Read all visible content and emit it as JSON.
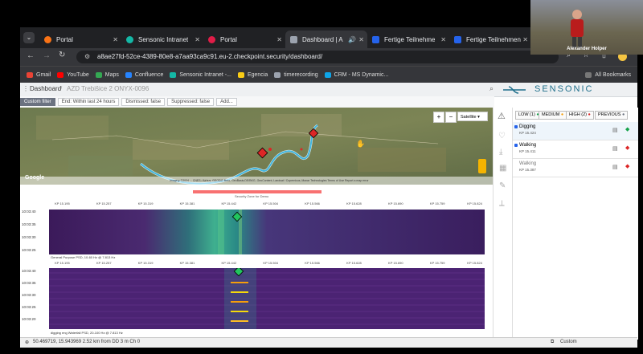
{
  "browser": {
    "tabs": [
      {
        "label": "Portal",
        "color": "#f97316",
        "active": false
      },
      {
        "label": "Sensonic Intranet",
        "color": "#14b8a6",
        "active": false
      },
      {
        "label": "Portal",
        "color": "#e11d48",
        "active": false
      },
      {
        "label": "Dashboard | A",
        "color": "#9ca3af",
        "active": true
      },
      {
        "label": "Fertige Teilnehme",
        "color": "#2563eb",
        "active": false
      },
      {
        "label": "Fertige Teilnehmen",
        "color": "#2563eb",
        "active": false
      }
    ],
    "url": "a8ae27fd-52ce-4389-80e8-a7aa93ca9c91.eu-2.checkpoint.security/dashboard/",
    "bookmarks": [
      {
        "label": "Gmail",
        "color": "#ea4335"
      },
      {
        "label": "YouTube",
        "color": "#ff0000"
      },
      {
        "label": "Maps",
        "color": "#34a853"
      },
      {
        "label": "Confluence",
        "color": "#2684ff"
      },
      {
        "label": "Sensonic Intranet -...",
        "color": "#14b8a6"
      },
      {
        "label": "Egencia",
        "color": "#facc15"
      },
      {
        "label": "timerecording",
        "color": "#9ca3af"
      },
      {
        "label": "CRM - MS Dynamic...",
        "color": "#0ea5e9"
      }
    ],
    "all_bookmarks": "All Bookmarks"
  },
  "webcam": {
    "name": "Alexander Holper"
  },
  "app": {
    "breadcrumb": "Dashboard",
    "asset": "AZD Trebišice 2 ONYX-0096",
    "brand": "SENSONIC",
    "filters": {
      "label": "Custom filter",
      "chips": [
        "End: Within last 24 hours",
        "Dismissed: false",
        "Suppressed: false",
        "Add..."
      ]
    },
    "map": {
      "layer": "Satellite",
      "zoom_in": "+",
      "zoom_out": "−",
      "google": "Google",
      "attribution": "Imagery ©2024 ... CNES / Airbus, GEODIS Brno, GeoBasis-DE/BKG, GeoContent, Landsat / Copernicus, Maxar Technologies   Terms of Use   Report a map error"
    },
    "security_zone": "Security Zone for Demo",
    "kp_ticks": [
      "KP 15.195",
      "KP 15.257",
      "KP 15.319",
      "KP 15.381",
      "KP 15.442",
      "KP 15.504",
      "KP 15.566",
      "KP 15.628",
      "KP 15.690",
      "KP 15.759",
      "KP 15.824"
    ],
    "waterfall1": {
      "times": [
        "10:03:40",
        "10:03:35",
        "10:03:30",
        "10:03:25"
      ],
      "caption": "General Purpose PSD, 10-60 Hz @ 7.813 Hz"
    },
    "waterfall2": {
      "times": [
        "10:03:40",
        "10:03:35",
        "10:03:30",
        "10:03:25",
        "10:03:20"
      ],
      "caption": "digging eng Waterfall PSD, 20-100 Hz @ 7.813 Hz"
    },
    "severity": [
      {
        "label": "LOW (1)",
        "color": "#16a34a"
      },
      {
        "label": "MEDIUM",
        "color": "#f59e0b"
      },
      {
        "label": "HIGH (2)",
        "color": "#dc2626"
      },
      {
        "label": "PREVIOUS",
        "color": "#6b7280"
      }
    ],
    "alarms": [
      {
        "type": "Digging",
        "kp": "KP 15.424",
        "color": "#16a34a"
      },
      {
        "type": "Walking",
        "kp": "KP 15.411",
        "color": "#dc2626"
      },
      {
        "type": "Walking",
        "kp": "KP 15.387",
        "color": "#dc2626"
      }
    ],
    "status_coords": "50.469719, 15.943969 2.52 km from DD 3 m Ch 0",
    "status_mode": "Custom"
  }
}
